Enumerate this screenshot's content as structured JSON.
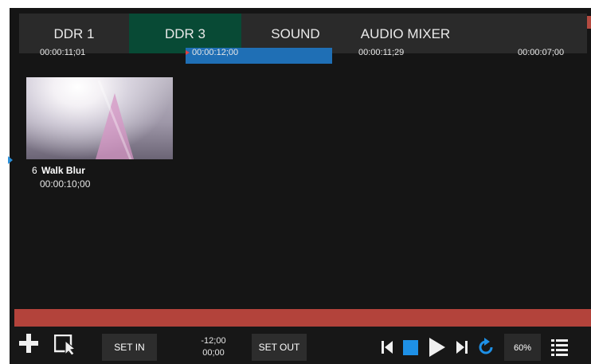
{
  "tabs": [
    {
      "label": "DDR 1",
      "active": false
    },
    {
      "label": "DDR 3",
      "active": true
    },
    {
      "label": "SOUND",
      "active": false
    },
    {
      "label": "AUDIO MIXER",
      "active": false
    }
  ],
  "top_row": [
    "00:00:11;01",
    "00:00:12;00",
    "00:00:11;29",
    "00:00:07;00"
  ],
  "clip": {
    "number": "6",
    "name": "Walk Blur",
    "duration": "00:00:10;00"
  },
  "toolbar": {
    "set_in_label": "SET IN",
    "time_top": "-12;00",
    "time_bottom": "00;00",
    "set_out_label": "SET OUT",
    "zoom_label": "60%"
  },
  "icons": {
    "add": "plus-icon",
    "select": "select-cursor-icon",
    "prev": "skip-previous-icon",
    "stop": "stop-icon",
    "play": "play-icon",
    "next": "skip-next-icon",
    "loop": "loop-icon",
    "menu": "list-menu-icon"
  },
  "colors": {
    "active_tab": "#084a35",
    "selected_row": "#1f6fb5",
    "red_bar": "#b3433b",
    "accent_blue": "#1e90e6"
  }
}
